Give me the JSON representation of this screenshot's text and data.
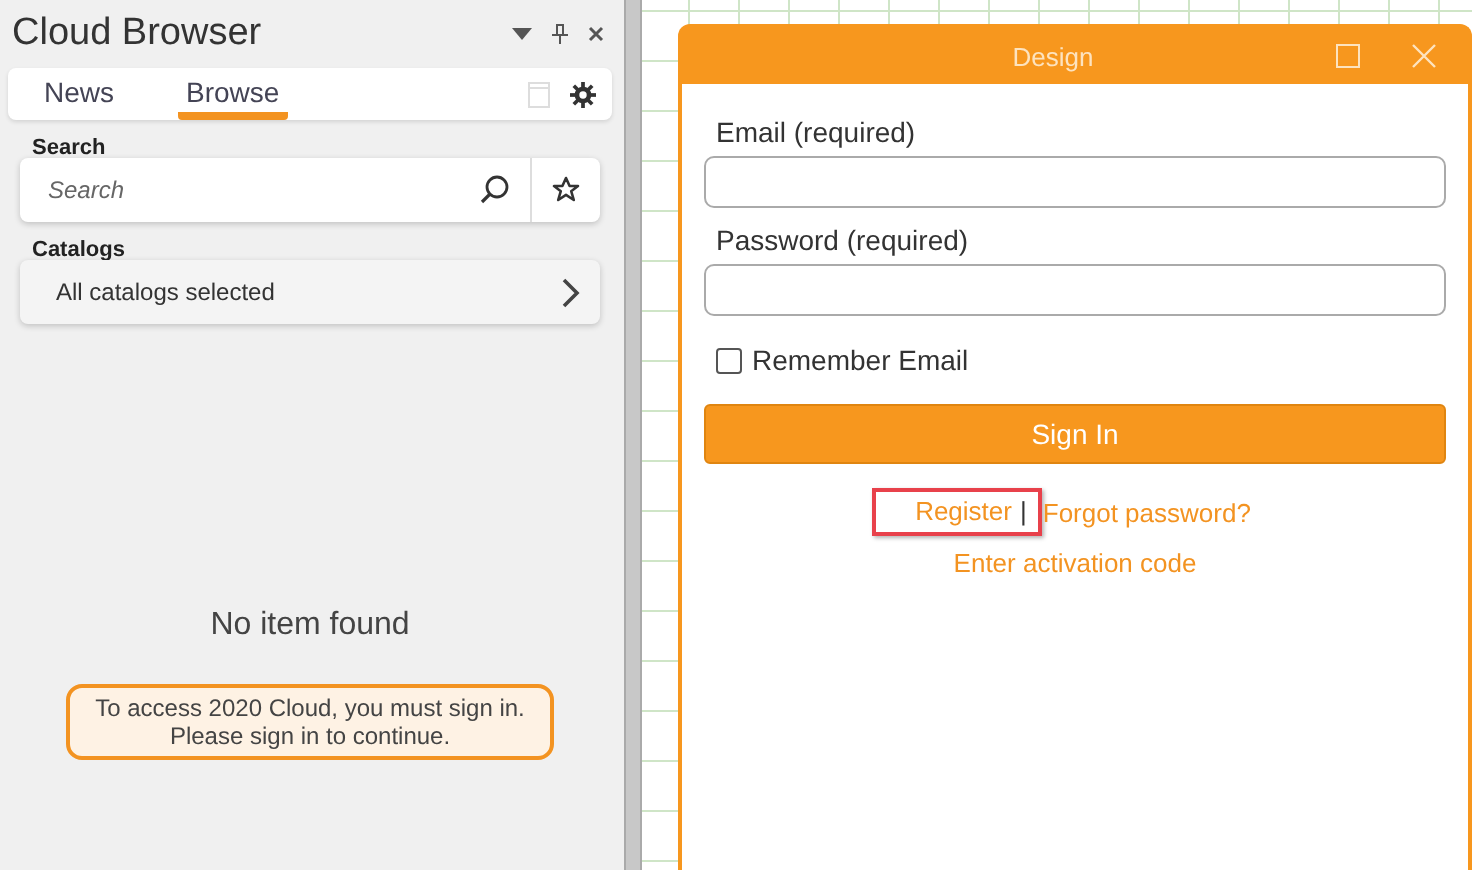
{
  "panel": {
    "title": "Cloud Browser"
  },
  "tabs": [
    {
      "label": "News",
      "selected": false
    },
    {
      "label": "Browse",
      "selected": true
    }
  ],
  "search": {
    "label": "Search",
    "placeholder": "Search"
  },
  "catalogs": {
    "label": "Catalogs",
    "value": "All catalogs selected"
  },
  "empty_message": "No item found",
  "notice": [
    "To access 2020 Cloud, you must sign in.",
    "Please sign in to continue."
  ],
  "dialog": {
    "title": "Design",
    "fields": [
      {
        "label": "Email (required)"
      },
      {
        "label": "Password (required)"
      }
    ],
    "remember": {
      "label": "Remember Email",
      "checked": false
    },
    "button": "Sign In",
    "links": [
      {
        "text": "Register",
        "highlighted": true
      },
      {
        "text": "Forgot password?",
        "highlighted": false
      }
    ],
    "separator": "|",
    "activation_link": "Enter activation code"
  }
}
